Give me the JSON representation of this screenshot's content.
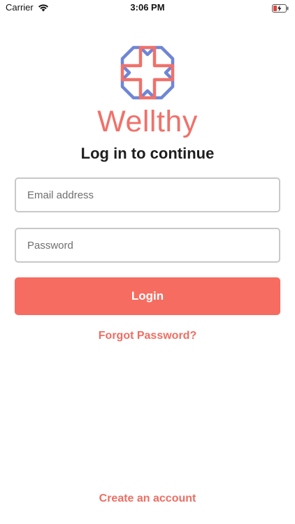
{
  "status_bar": {
    "carrier": "Carrier",
    "time": "3:06 PM",
    "wifi_icon": "wifi-icon",
    "battery_icon": "battery-charging-icon"
  },
  "brand": {
    "name": "Wellthy",
    "logo_icon": "wellthy-logo",
    "color": "#f0716a",
    "logo_colors": [
      "#6f86d6",
      "#f0716a"
    ]
  },
  "login": {
    "heading": "Log in to continue",
    "email_placeholder": "Email address",
    "email_value": "",
    "password_placeholder": "Password",
    "password_value": "",
    "submit_label": "Login",
    "forgot_password": "Forgot Password?",
    "create_account": "Create an account",
    "accent_color": "#f66c61"
  }
}
